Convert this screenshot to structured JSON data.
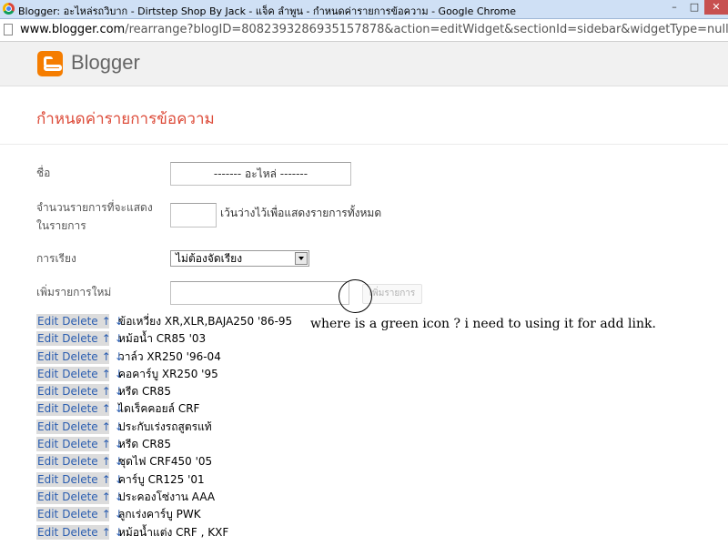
{
  "window": {
    "title": "Blogger: อะไหล่รถวิบาก - Dirtstep Shop By Jack - แจ็ค ลำพูน - กำหนดค่ารายการข้อความ - Google Chrome",
    "minimize": "–",
    "maximize": "□",
    "close": "✕"
  },
  "address": {
    "host": "www.blogger.com",
    "path": "/rearrange?blogID=8082393286935157878&action=editWidget&sectionId=sidebar&widgetType=null&"
  },
  "blogger": {
    "name": "Blogger"
  },
  "page": {
    "title": "กำหนดค่ารายการข้อความ"
  },
  "form": {
    "name_label": "ชื่อ",
    "name_value": "------- อะไหล่ -------",
    "count_label_line1": "จำนวนรายการที่จะแสดง",
    "count_label_line2": "ในรายการ",
    "count_value": "",
    "count_hint": "เว้นว่างไว้เพื่อแสดงรายการทั้งหมด",
    "sort_label": "การเรียง",
    "sort_value": "ไม่ต้องจัดเรียง",
    "new_item_label": "เพิ่มรายการใหม่",
    "new_item_value": "",
    "add_button": "เพิ่มรายการ"
  },
  "link_controls": {
    "edit": "Edit",
    "delete": "Delete",
    "up": "↑",
    "down": "↓"
  },
  "items": [
    "ข้อเหวี่ยง XR,XLR,BAJA250 '86-95",
    "หม้อน้ำ CR85 '03",
    "วาล์ว XR250 '96-04",
    "คอคาร์บู XR250 '95",
    "หรีด CR85",
    "ไดเร็คคอยล์ CRF",
    "ประกับเร่งรถสูตรแท้",
    "หรีด CR85",
    "ชุดไฟ CRF450 '05",
    "คาร์บู CR125 '01",
    "ประคองโซ่งาน AAA",
    "ลูกเร่งคาร์บู PWK",
    "หม้อน้ำแต่ง CRF , KXF"
  ],
  "annotation": {
    "text": "where is a green icon ? i need to using it for add link."
  },
  "colors": {
    "blogger_orange": "#f57d00",
    "title_red": "#dd4b39",
    "link_blue": "#2a5db0"
  }
}
